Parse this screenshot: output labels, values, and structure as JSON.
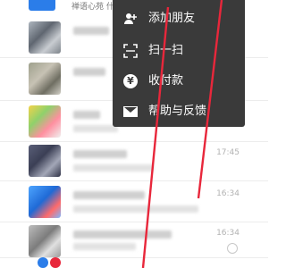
{
  "header": {
    "partial_title": "禅语心苑 什么你"
  },
  "menu": {
    "items": [
      {
        "label": "添加朋友",
        "icon": "add-friend-icon"
      },
      {
        "label": "扫一扫",
        "icon": "scan-icon"
      },
      {
        "label": "收付款",
        "icon": "payment-icon"
      },
      {
        "label": "帮助与反馈",
        "icon": "mail-icon"
      }
    ]
  },
  "chats": [
    {
      "time": ""
    },
    {
      "time": ""
    },
    {
      "time": ""
    },
    {
      "time": "17:45"
    },
    {
      "time": "16:34"
    },
    {
      "time": "16:34"
    }
  ],
  "colors": {
    "menu_bg": "#3a3a3a",
    "annotation_arrow": "#e8273b",
    "accent_blue": "#2b7de9"
  }
}
